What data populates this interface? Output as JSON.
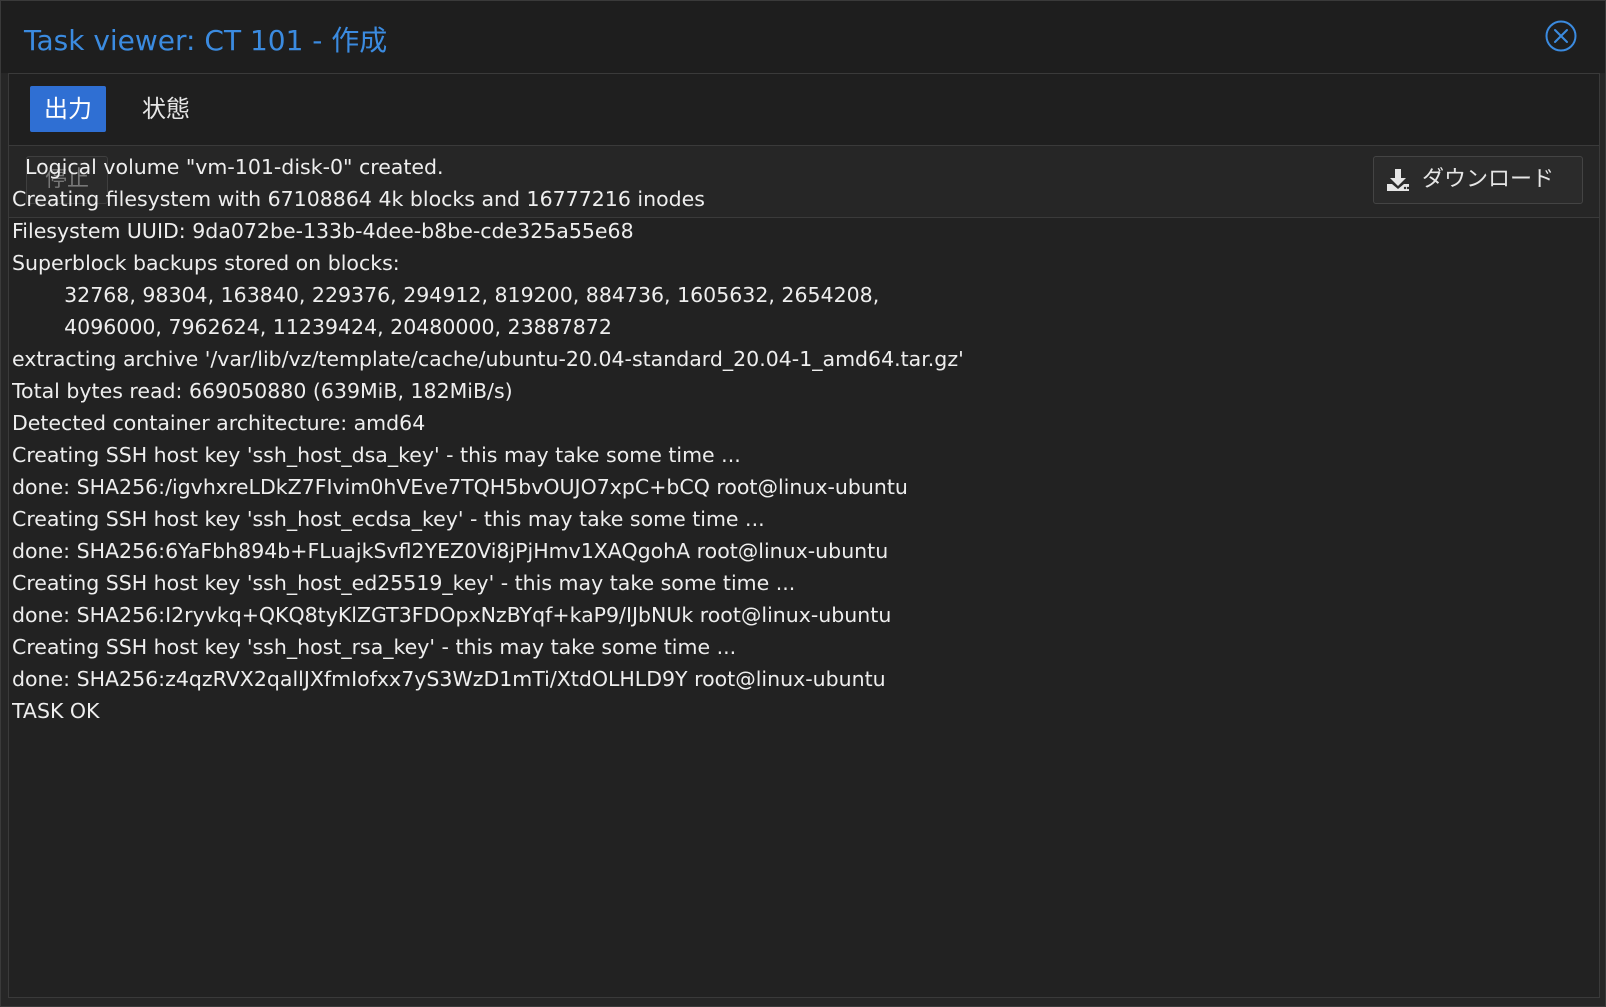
{
  "window": {
    "title": "Task viewer: CT 101 - 作成"
  },
  "tabs": [
    {
      "label": "出力",
      "active": true
    },
    {
      "label": "状態",
      "active": false
    }
  ],
  "toolbar": {
    "stop_label": "停止",
    "download_label": "ダウンロード"
  },
  "log": {
    "lines": [
      "  Logical volume \"vm-101-disk-0\" created.",
      "Creating filesystem with 67108864 4k blocks and 16777216 inodes",
      "Filesystem UUID: 9da072be-133b-4dee-b8be-cde325a55e68",
      "Superblock backups stored on blocks:",
      "        32768, 98304, 163840, 229376, 294912, 819200, 884736, 1605632, 2654208,",
      "        4096000, 7962624, 11239424, 20480000, 23887872",
      "extracting archive '/var/lib/vz/template/cache/ubuntu-20.04-standard_20.04-1_amd64.tar.gz'",
      "Total bytes read: 669050880 (639MiB, 182MiB/s)",
      "Detected container architecture: amd64",
      "Creating SSH host key 'ssh_host_dsa_key' - this may take some time ...",
      "done: SHA256:/igvhxreLDkZ7FIvim0hVEve7TQH5bvOUJO7xpC+bCQ root@linux-ubuntu",
      "Creating SSH host key 'ssh_host_ecdsa_key' - this may take some time ...",
      "done: SHA256:6YaFbh894b+FLuajkSvfl2YEZ0Vi8jPjHmv1XAQgohA root@linux-ubuntu",
      "Creating SSH host key 'ssh_host_ed25519_key' - this may take some time ...",
      "done: SHA256:I2ryvkq+QKQ8tyKlZGT3FDOpxNzBYqf+kaP9/IJbNUk root@linux-ubuntu",
      "Creating SSH host key 'ssh_host_rsa_key' - this may take some time ...",
      "done: SHA256:z4qzRVX2qallJXfmIofxx7yS3WzD1mTi/XtdOLHLD9Y root@linux-ubuntu",
      "TASK OK"
    ]
  },
  "colors": {
    "accent": "#2f6fd3",
    "title": "#3b8be0",
    "text": "#eeeeee",
    "background": "#222222"
  },
  "icons": {
    "close": "close-circle-icon",
    "download": "download-icon"
  }
}
